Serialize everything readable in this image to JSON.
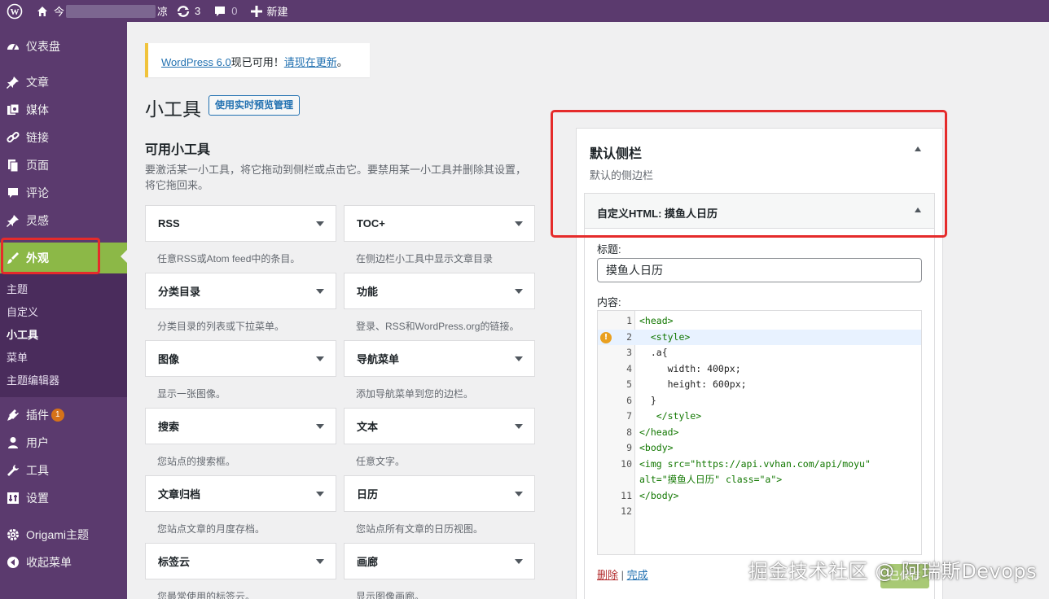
{
  "adminbar": {
    "site_name_start": "今",
    "site_name_end": "凉",
    "updates_count": "3",
    "comments_count": "0",
    "new_label": "新建"
  },
  "sidebar": {
    "items": [
      {
        "label": "仪表盘",
        "icon": "dashboard-icon"
      },
      {
        "label": "文章",
        "icon": "pin-icon"
      },
      {
        "label": "媒体",
        "icon": "media-icon"
      },
      {
        "label": "链接",
        "icon": "link-icon"
      },
      {
        "label": "页面",
        "icon": "page-icon"
      },
      {
        "label": "评论",
        "icon": "comment-icon"
      },
      {
        "label": "灵感",
        "icon": "pin-icon"
      },
      {
        "label": "外观",
        "icon": "brush-icon"
      }
    ],
    "appearance_sub": [
      "主题",
      "自定义",
      "小工具",
      "菜单",
      "主题编辑器"
    ],
    "items2": [
      {
        "label": "插件",
        "icon": "plugin-icon",
        "badge": "1"
      },
      {
        "label": "用户",
        "icon": "user-icon"
      },
      {
        "label": "工具",
        "icon": "wrench-icon"
      },
      {
        "label": "设置",
        "icon": "settings-icon"
      },
      {
        "label": "Origami主题",
        "icon": "gear-icon"
      },
      {
        "label": "收起菜单",
        "icon": "collapse-icon"
      }
    ]
  },
  "notice": {
    "link1": "WordPress 6.0",
    "text": "现已可用！",
    "link2": "请现在更新",
    "end": "。"
  },
  "page": {
    "title": "小工具",
    "manage_button": "使用实时预览管理",
    "available_title": "可用小工具",
    "available_desc": "要激活某一小工具，将它拖动到侧栏或点击它。要禁用某一小工具并删除其设置，将它拖回来。"
  },
  "widgets": [
    {
      "name": "RSS",
      "desc": "任意RSS或Atom feed中的条目。"
    },
    {
      "name": "TOC+",
      "desc": "在侧边栏小工具中显示文章目录"
    },
    {
      "name": "分类目录",
      "desc": "分类目录的列表或下拉菜单。"
    },
    {
      "name": "功能",
      "desc": "登录、RSS和WordPress.org的链接。"
    },
    {
      "name": "图像",
      "desc": "显示一张图像。"
    },
    {
      "name": "导航菜单",
      "desc": "添加导航菜单到您的边栏。"
    },
    {
      "name": "搜索",
      "desc": "您站点的搜索框。"
    },
    {
      "name": "文本",
      "desc": "任意文字。"
    },
    {
      "name": "文章归档",
      "desc": "您站点文章的月度存档。"
    },
    {
      "name": "日历",
      "desc": "您站点所有文章的日历视图。"
    },
    {
      "name": "标签云",
      "desc": "您最常使用的标签云。"
    },
    {
      "name": "画廊",
      "desc": "显示图像画廊。"
    }
  ],
  "sidebar_area": {
    "title": "默认侧栏",
    "desc": "默认的侧边栏",
    "widget_title": "自定义HTML: 摸鱼人日历",
    "label_title": "标题:",
    "title_value": "摸鱼人日历",
    "label_content": "内容:",
    "delete_label": "删除",
    "separator": "|",
    "done_label": "完成",
    "save_label": "已保存"
  },
  "code_lines": [
    {
      "n": "1",
      "text": "<head>"
    },
    {
      "n": "2",
      "text": "  <style>"
    },
    {
      "n": "3",
      "text": "  .a{"
    },
    {
      "n": "4",
      "text": "     width: 400px;"
    },
    {
      "n": "5",
      "text": "     height: 600px;"
    },
    {
      "n": "6",
      "text": "  }"
    },
    {
      "n": "7",
      "text": "   </style>"
    },
    {
      "n": "8",
      "text": "</head>"
    },
    {
      "n": "9",
      "text": "<body>"
    },
    {
      "n": "10",
      "text": "<img src=\"https://api.vvhan.com/api/moyu\""
    },
    {
      "n": "",
      "text": "alt=\"摸鱼人日历\" class=\"a\">"
    },
    {
      "n": "11",
      "text": "</body>"
    },
    {
      "n": "12",
      "text": ""
    }
  ],
  "watermark": "掘金技术社区 @ 阿瑞斯Devops",
  "colors": {
    "sidebar_bg": "#5b3a6e",
    "active_menu": "#8cb847",
    "link": "#2271b1",
    "highlight_box": "#e52b2b"
  }
}
